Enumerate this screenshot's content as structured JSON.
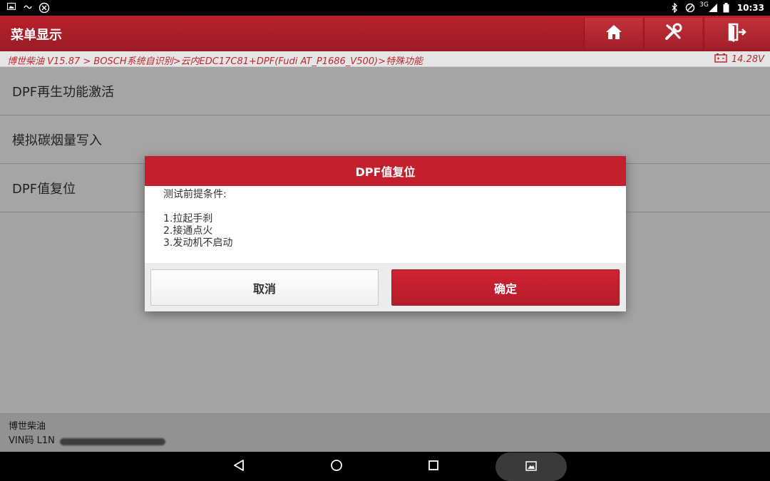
{
  "status_bar": {
    "time": "10:33",
    "network": "3G",
    "icons": [
      "image-icon",
      "usb-icon",
      "settings-icon",
      "bluetooth-icon",
      "alarm-icon",
      "signal-icon",
      "battery-icon"
    ]
  },
  "header": {
    "title": "菜单显示",
    "buttons": [
      "home-icon",
      "tools-icon",
      "exit-icon"
    ]
  },
  "breadcrumb": {
    "path": "博世柴油 V15.87 > BOSCH系统自识别>云内EDC17C81+DPF(Fudi AT_P1686_V500)>特殊功能",
    "voltage": "14.28V"
  },
  "menu": {
    "items": [
      {
        "label": "DPF再生功能激活"
      },
      {
        "label": "模拟碳烟量写入"
      },
      {
        "label": "DPF值复位"
      }
    ]
  },
  "footer": {
    "line1": "博世柴油",
    "line2": "VIN码 L1N"
  },
  "dialog": {
    "title": "DPF值复位",
    "heading": "测试前提条件:",
    "conditions": [
      "1.拉起手刹",
      "2.接通点火",
      "3.发动机不启动"
    ],
    "cancel_label": "取消",
    "ok_label": "确定"
  },
  "colors": {
    "accent": "#c41f2d",
    "header": "#a81d27",
    "breadcrumb_text": "#c1272d"
  }
}
